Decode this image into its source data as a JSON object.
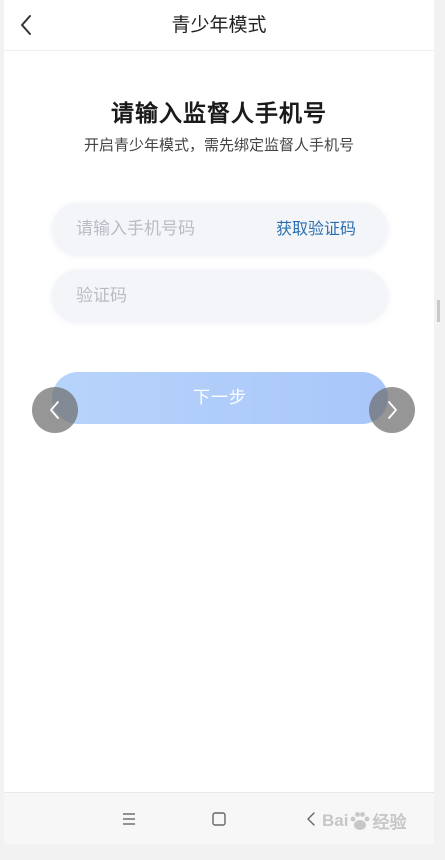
{
  "header": {
    "title": "青少年模式"
  },
  "main": {
    "title": "请输入监督人手机号",
    "subtitle": "开启青少年模式，需先绑定监督人手机号"
  },
  "phone": {
    "placeholder": "请输入手机号码",
    "value": "",
    "get_code_label": "获取验证码"
  },
  "code": {
    "placeholder": "验证码",
    "value": ""
  },
  "next_label": "下一步",
  "colors": {
    "link": "#2c6fb0",
    "button_start": "#b7d4fb",
    "button_end": "#a9c6fa",
    "field_bg": "#f3f5f8"
  },
  "icons": {
    "back": "chevron-left-icon",
    "carousel_prev": "chevron-left-icon",
    "carousel_next": "chevron-right-icon",
    "nav_menu": "menu-icon",
    "nav_home": "square-icon",
    "nav_back": "chevron-left-icon"
  },
  "watermark": {
    "text_prefix": "Bai",
    "text_suffix": "经验"
  }
}
